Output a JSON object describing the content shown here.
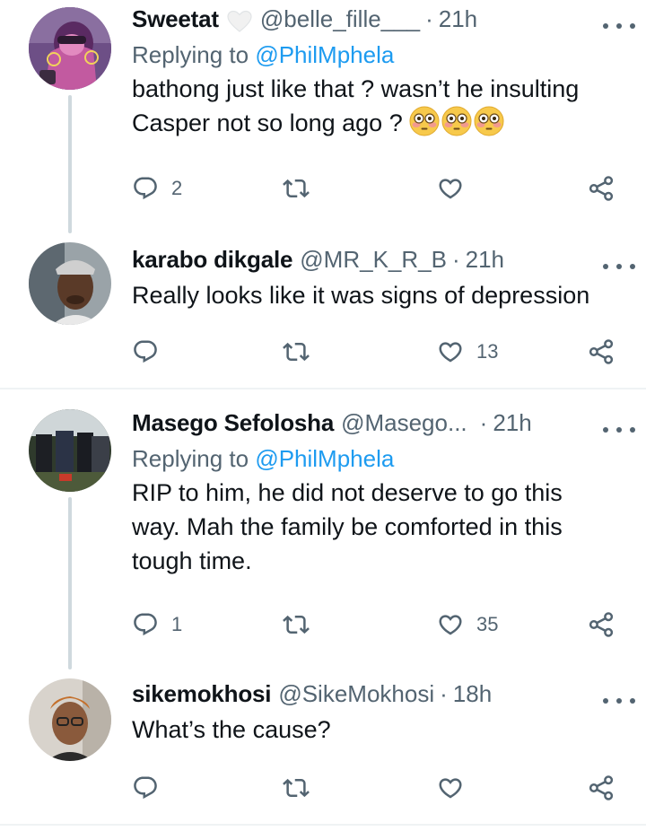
{
  "tweets": [
    {
      "display_name": "Sweetat",
      "handle": "@belle_fille___",
      "separator": "·",
      "time": "21h",
      "replying_prefix": "Replying to ",
      "replying_to": "@PhilMphela",
      "text": "bathong just like that ? wasn’t he insulting\nCasper not so long ago ?",
      "emoji": [
        "flushed-face-icon",
        "flushed-face-icon",
        "flushed-face-icon"
      ],
      "reply_count": "2",
      "retweet_count": "",
      "like_count": ""
    },
    {
      "display_name": "karabo dikgale",
      "handle": "@MR_K_R_B",
      "separator": "·",
      "time": "21h",
      "text": "Really looks like it was signs of depression",
      "reply_count": "",
      "retweet_count": "",
      "like_count": "13"
    },
    {
      "display_name": "Masego Sefolosha",
      "handle": "@Masego...",
      "separator": "·",
      "time": "21h",
      "replying_prefix": "Replying to ",
      "replying_to": "@PhilMphela",
      "text": "RIP to him, he did not deserve to go this\nway. Mah the family be comforted in this\ntough time.",
      "reply_count": "1",
      "retweet_count": "",
      "like_count": "35"
    },
    {
      "display_name": "sikemokhosi",
      "handle": "@SikeMokhosi",
      "separator": "·",
      "time": "18h",
      "text": "What’s the cause?",
      "reply_count": "",
      "retweet_count": "",
      "like_count": ""
    }
  ],
  "colors": {
    "text": "#0f1419",
    "secondary": "#536471",
    "link": "#1d9bf0",
    "thread_line": "#cfd9de",
    "divider": "#eff3f4"
  }
}
